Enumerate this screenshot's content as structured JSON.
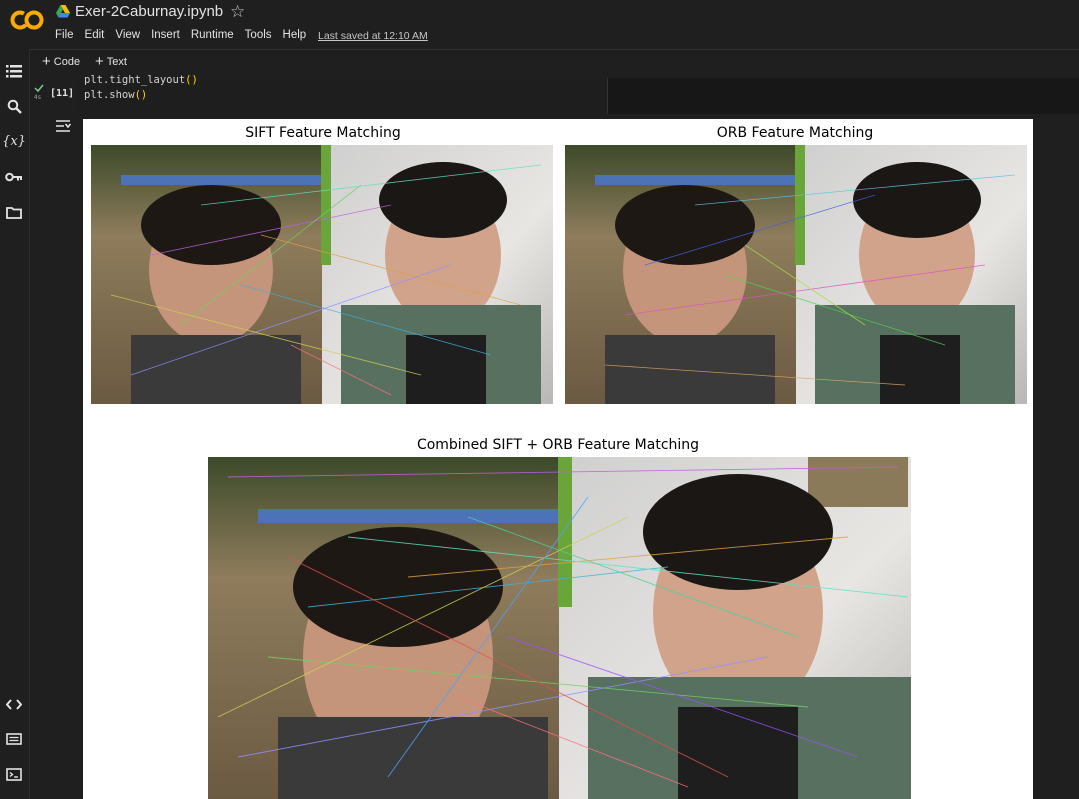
{
  "header": {
    "notebook_title": "Exer-2Caburnay.ipynb",
    "last_saved": "Last saved at 12:10 AM",
    "icons": {
      "logo": "colab-logo",
      "drive": "google-drive-icon",
      "star": "star-icon"
    }
  },
  "menu": [
    "File",
    "Edit",
    "View",
    "Insert",
    "Runtime",
    "Tools",
    "Help"
  ],
  "toolbar": {
    "code_label": "Code",
    "text_label": "Text"
  },
  "rail": [
    "table-of-contents-icon",
    "search-icon",
    "variables-icon",
    "secrets-key-icon",
    "files-folder-icon",
    "code-snippets-icon",
    "command-palette-icon",
    "terminal-icon"
  ],
  "cell": {
    "execution_count": "[11]",
    "exec_time": "4s",
    "code_lines": [
      {
        "fn": "plt.tight_layout",
        "open": "(",
        "close": ")"
      },
      {
        "fn": "plt.show",
        "open": "(",
        "close": ")"
      }
    ]
  },
  "output": {
    "titles": {
      "sift": "SIFT Feature Matching",
      "orb": "ORB Feature Matching",
      "combined": "Combined SIFT + ORB Feature Matching"
    }
  },
  "colors": {
    "background": "#1f1f1f",
    "output_bg": "#ffffff",
    "accent_orange": "#f9ab00",
    "check_green": "#81c995"
  }
}
